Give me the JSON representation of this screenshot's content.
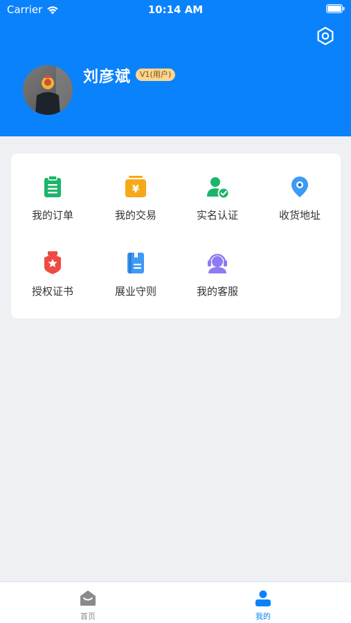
{
  "status_bar": {
    "carrier": "Carrier",
    "time": "10:14 AM"
  },
  "profile": {
    "name": "刘彦斌",
    "level": "V1(用户)"
  },
  "menu": {
    "items": [
      {
        "label": "我的订单",
        "icon": "clipboard-icon",
        "color": "#1bb56a"
      },
      {
        "label": "我的交易",
        "icon": "yuan-wallet-icon",
        "color": "#f5a818"
      },
      {
        "label": "实名认证",
        "icon": "user-verified-icon",
        "color": "#1bb56a"
      },
      {
        "label": "收货地址",
        "icon": "location-pin-icon",
        "color": "#3d9af5"
      },
      {
        "label": "授权证书",
        "icon": "certificate-badge-icon",
        "color": "#ee4b42"
      },
      {
        "label": "展业守则",
        "icon": "book-icon",
        "color": "#3d9af5"
      },
      {
        "label": "我的客服",
        "icon": "headset-icon",
        "color": "#8e7bf2"
      }
    ]
  },
  "tabbar": {
    "home_label": "首页",
    "mine_label": "我的",
    "active_color": "#0a82fb",
    "inactive_color": "#8a8a8a"
  },
  "colors": {
    "header": "#0a82fb",
    "background": "#eff0f4"
  }
}
